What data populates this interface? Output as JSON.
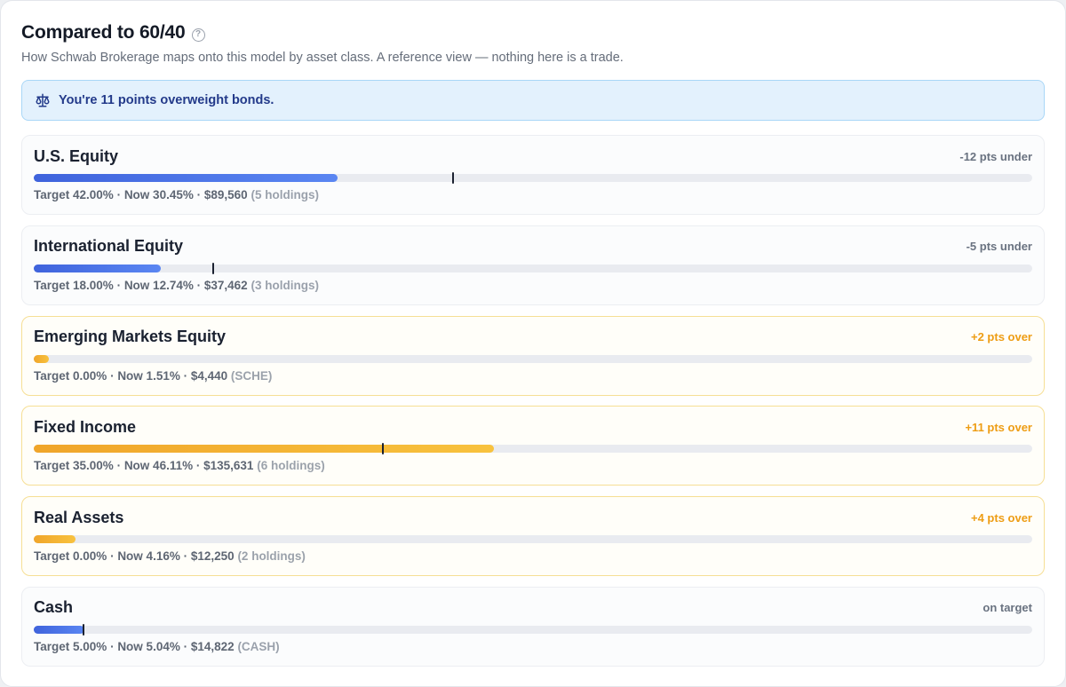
{
  "header": {
    "title": "Compared to 60/40",
    "subtitle": "How Schwab Brokerage maps onto this model by asset class. A reference view — nothing here is a trade."
  },
  "alert": {
    "text": "You're 11 points overweight bonds."
  },
  "colors": {
    "under_fill": "#4a6fe6",
    "over_fill": "#f4b232",
    "alert_bg": "#e3f1fd",
    "alert_text": "#233a8a",
    "over_label": "#ee9d14"
  },
  "rows": [
    {
      "name": "U.S. Equity",
      "delta": "-12 pts under",
      "status": "under",
      "target_pct": 42.0,
      "now_pct": 30.45,
      "target": "Target 42.00%",
      "now": "Now 30.45%",
      "amount": "$89,560",
      "holdings": "(5 holdings)"
    },
    {
      "name": "International Equity",
      "delta": "-5 pts under",
      "status": "under",
      "target_pct": 18.0,
      "now_pct": 12.74,
      "target": "Target 18.00%",
      "now": "Now 12.74%",
      "amount": "$37,462",
      "holdings": "(3 holdings)"
    },
    {
      "name": "Emerging Markets Equity",
      "delta": "+2 pts over",
      "status": "over",
      "target_pct": 0.0,
      "now_pct": 1.51,
      "target": "Target 0.00%",
      "now": "Now 1.51%",
      "amount": "$4,440",
      "holdings": "(SCHE)"
    },
    {
      "name": "Fixed Income",
      "delta": "+11 pts over",
      "status": "over",
      "target_pct": 35.0,
      "now_pct": 46.11,
      "target": "Target 35.00%",
      "now": "Now 46.11%",
      "amount": "$135,631",
      "holdings": "(6 holdings)"
    },
    {
      "name": "Real Assets",
      "delta": "+4 pts over",
      "status": "over",
      "target_pct": 0.0,
      "now_pct": 4.16,
      "target": "Target 0.00%",
      "now": "Now 4.16%",
      "amount": "$12,250",
      "holdings": "(2 holdings)"
    },
    {
      "name": "Cash",
      "delta": "on target",
      "status": "on",
      "target_pct": 5.0,
      "now_pct": 5.04,
      "target": "Target 5.00%",
      "now": "Now 5.04%",
      "amount": "$14,822",
      "holdings": "(CASH)"
    }
  ]
}
